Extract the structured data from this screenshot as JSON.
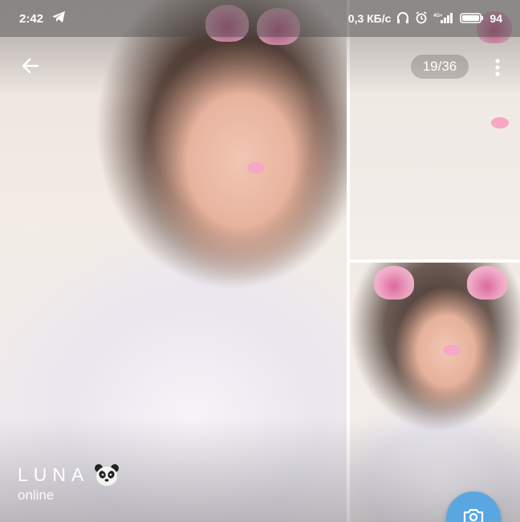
{
  "status_bar": {
    "time": "2:42",
    "network_speed": "0,3 КБ/с",
    "network_type": "4G+",
    "battery_percent": "94",
    "icons": [
      "telegram-icon",
      "headphones-icon",
      "alarm-icon",
      "signal-icon",
      "battery-icon"
    ]
  },
  "toolbar": {
    "counter": "19/36",
    "icons": [
      "back-arrow-icon",
      "more-vertical-icon"
    ]
  },
  "profile": {
    "name": "LUNA",
    "name_emoji": "panda-icon",
    "status": "online"
  },
  "fab": {
    "icon": "camera-icon",
    "color": "#5aa6e0"
  }
}
